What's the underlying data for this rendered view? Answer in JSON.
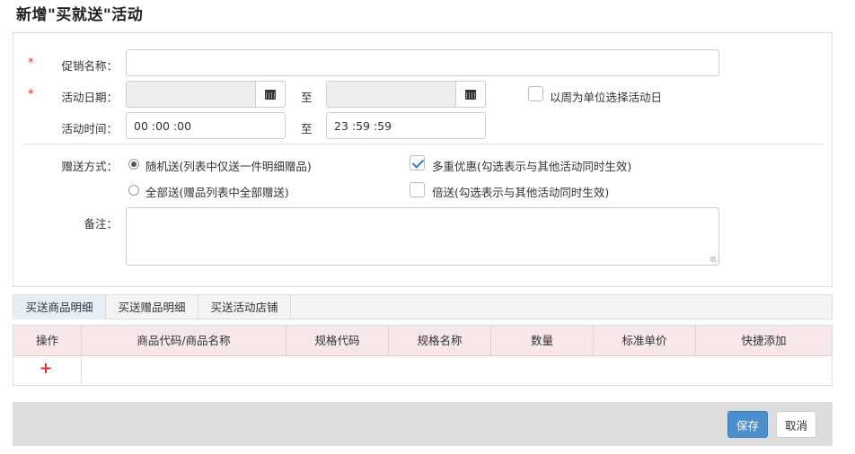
{
  "page": {
    "title": "新增\"买就送\"活动"
  },
  "form": {
    "required_mark": "*",
    "promo_name": {
      "label": "促销名称：",
      "value": ""
    },
    "date": {
      "label": "活动日期：",
      "start": "",
      "end": "",
      "to": "至",
      "week_option": "以周为单位选择活动日",
      "week_checked": false
    },
    "time": {
      "label": "活动时间：",
      "start": "00 :00 :00",
      "end": "23 :59 :59",
      "to": "至"
    },
    "gift": {
      "label": "赠送方式：",
      "random": "随机送(列表中仅送一件明细赠品)",
      "all": "全部送(赠品列表中全部赠送)",
      "selected": "random",
      "multi": "多重优惠(勾选表示与其他活动同时生效)",
      "multi_checked": true,
      "double": "倍送(勾选表示与其他活动同时生效)",
      "double_checked": false
    },
    "note": {
      "label": "备注：",
      "value": ""
    }
  },
  "tabs": [
    "买送商品明细",
    "买送赠品明细",
    "买送活动店铺"
  ],
  "active_tab": 0,
  "table": {
    "columns": [
      "操作",
      "商品代码/商品名称",
      "规格代码",
      "规格名称",
      "数量",
      "标准单价",
      "快捷添加"
    ],
    "add_symbol": "+"
  },
  "footer": {
    "save": "保存",
    "cancel": "取消"
  },
  "icons": {
    "date_picker": "calendar-icon",
    "add": "plus-icon"
  },
  "colors": {
    "required": "#d9362f",
    "primary": "#4a8ecb",
    "header_bg": "#f8e7ea",
    "check": "#2a7bd4"
  }
}
